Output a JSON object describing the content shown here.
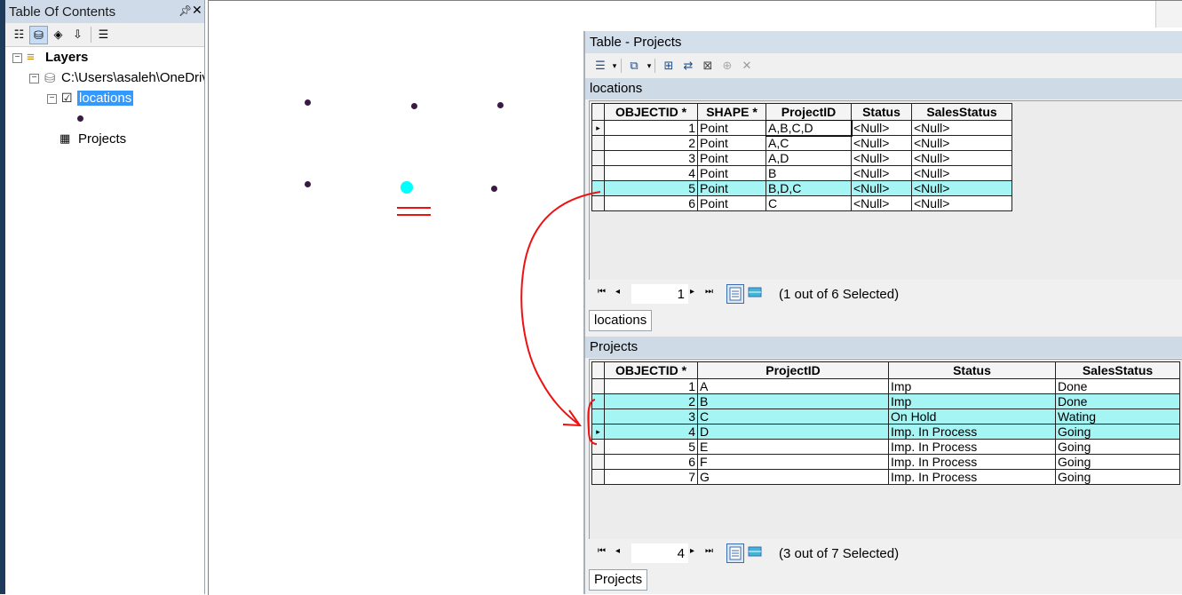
{
  "toc": {
    "title": "Table Of Contents",
    "pin_icon": "pin-icon",
    "close_icon": "close-icon",
    "root_label": "Layers",
    "workspace_label": "C:\\Users\\asaleh\\OneDriv",
    "layer_label": "locations",
    "table_label": "Projects"
  },
  "table_window": {
    "title": "Table - Projects",
    "locations": {
      "section_title": "locations",
      "columns": [
        "OBJECTID *",
        "SHAPE *",
        "ProjectID",
        "Status",
        "SalesStatus"
      ],
      "rows": [
        {
          "objectid": "1",
          "shape": "Point",
          "projectid": "A,B,C,D",
          "status": "<Null>",
          "sales": "<Null>",
          "selected": false,
          "current": true
        },
        {
          "objectid": "2",
          "shape": "Point",
          "projectid": "A,C",
          "status": "<Null>",
          "sales": "<Null>",
          "selected": false,
          "current": false
        },
        {
          "objectid": "3",
          "shape": "Point",
          "projectid": "A,D",
          "status": "<Null>",
          "sales": "<Null>",
          "selected": false,
          "current": false
        },
        {
          "objectid": "4",
          "shape": "Point",
          "projectid": "B",
          "status": "<Null>",
          "sales": "<Null>",
          "selected": false,
          "current": false
        },
        {
          "objectid": "5",
          "shape": "Point",
          "projectid": "B,D,C",
          "status": "<Null>",
          "sales": "<Null>",
          "selected": true,
          "current": false
        },
        {
          "objectid": "6",
          "shape": "Point",
          "projectid": "C",
          "status": "<Null>",
          "sales": "<Null>",
          "selected": false,
          "current": false
        }
      ],
      "nav_record": "1",
      "nav_status": "(1 out of 6 Selected)",
      "tab_label": "locations"
    },
    "projects": {
      "section_title": "Projects",
      "columns": [
        "OBJECTID *",
        "ProjectID",
        "Status",
        "SalesStatus"
      ],
      "rows": [
        {
          "objectid": "1",
          "projectid": "A",
          "status": "Imp",
          "sales": "Done",
          "selected": false,
          "current": false
        },
        {
          "objectid": "2",
          "projectid": "B",
          "status": "Imp",
          "sales": "Done",
          "selected": true,
          "current": false
        },
        {
          "objectid": "3",
          "projectid": "C",
          "status": "On Hold",
          "sales": "Wating",
          "selected": true,
          "current": false
        },
        {
          "objectid": "4",
          "projectid": "D",
          "status": "Imp. In Process",
          "sales": "Going",
          "selected": true,
          "current": true
        },
        {
          "objectid": "5",
          "projectid": "E",
          "status": "Imp. In Process",
          "sales": "Going",
          "selected": false,
          "current": false
        },
        {
          "objectid": "6",
          "projectid": "F",
          "status": "Imp. In Process",
          "sales": "Going",
          "selected": false,
          "current": false
        },
        {
          "objectid": "7",
          "projectid": "G",
          "status": "Imp. In Process",
          "sales": "Going",
          "selected": false,
          "current": false
        }
      ],
      "nav_record": "4",
      "nav_status": "(3 out of 7 Selected)",
      "tab_label": "Projects"
    }
  },
  "colors": {
    "selection": "#a6f5f5",
    "selected_point": "#00ffff",
    "annotation": "#e11111",
    "toc_highlight": "#3399ff"
  }
}
